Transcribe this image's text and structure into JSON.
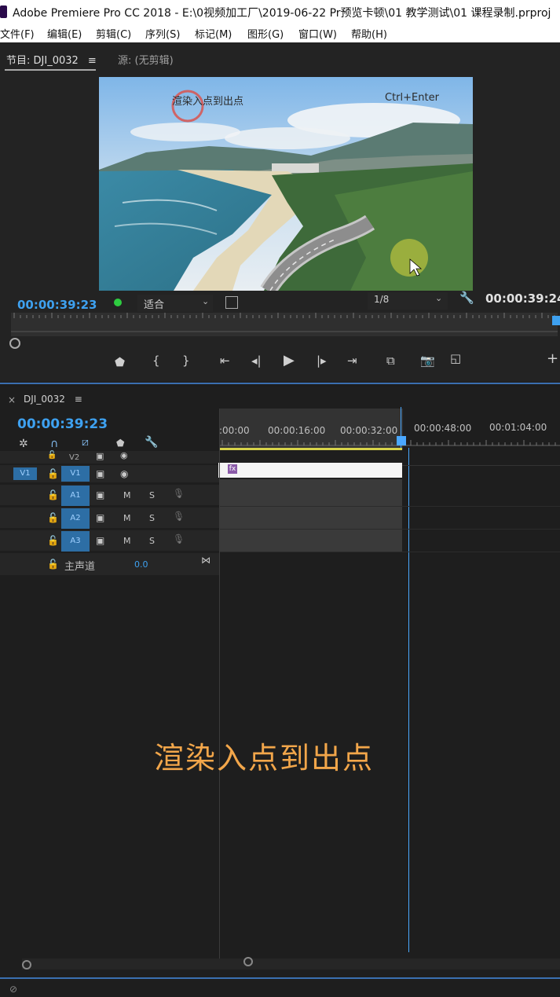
{
  "window": {
    "title": "Adobe Premiere Pro CC 2018 - E:\\0视频加工厂\\2019-06-22 Pr预览卡顿\\01 教学测试\\01 课程录制.prproj"
  },
  "menu": [
    "文件(F)",
    "编辑(E)",
    "剪辑(C)",
    "序列(S)",
    "标记(M)",
    "图形(G)",
    "窗口(W)",
    "帮助(H)"
  ],
  "program_monitor": {
    "tab_label": "节目: DJI_0032",
    "menu_glyph": "≡",
    "source_label": "源: (无剪辑)",
    "video_caption": "渲染入点到出点",
    "video_shortcut": "Ctrl+Enter",
    "timecode_current": "00:00:39:23",
    "fit_value": "适合",
    "resolution": "1/8",
    "timecode_duration": "00:00:39:24"
  },
  "transport": {
    "icons": [
      "marker-icon",
      "mark-in-icon",
      "mark-out-icon",
      "go-to-in-icon",
      "step-back-icon",
      "play-icon",
      "step-forward-icon",
      "go-to-out-icon",
      "lift-icon",
      "camera-icon",
      "compare-icon",
      "add-button-icon"
    ]
  },
  "timeline": {
    "tab_label": "DJI_0032",
    "menu_glyph": "≡",
    "close_glyph": "×",
    "timecode": "00:00:39:23",
    "ruler_labels": [
      ":00:00",
      "00:00:16:00",
      "00:00:32:00",
      "00:00:48:00",
      "00:01:04:00"
    ],
    "tracks": {
      "v2": "V2",
      "v1": "V1",
      "v1_src": "V1",
      "a1": "A1",
      "a2": "A2",
      "a3": "A3",
      "m": "M",
      "s": "S"
    },
    "master_label": "主声道",
    "master_value": "0.0",
    "clip_fx": "fx"
  },
  "overlay_caption": "渲染入点到出点",
  "colors": {
    "timecode_blue": "#3ea1f0",
    "track_target": "#2d6ea5",
    "caption_orange": "#f2a64a",
    "playhead": "#4aa8ff"
  }
}
